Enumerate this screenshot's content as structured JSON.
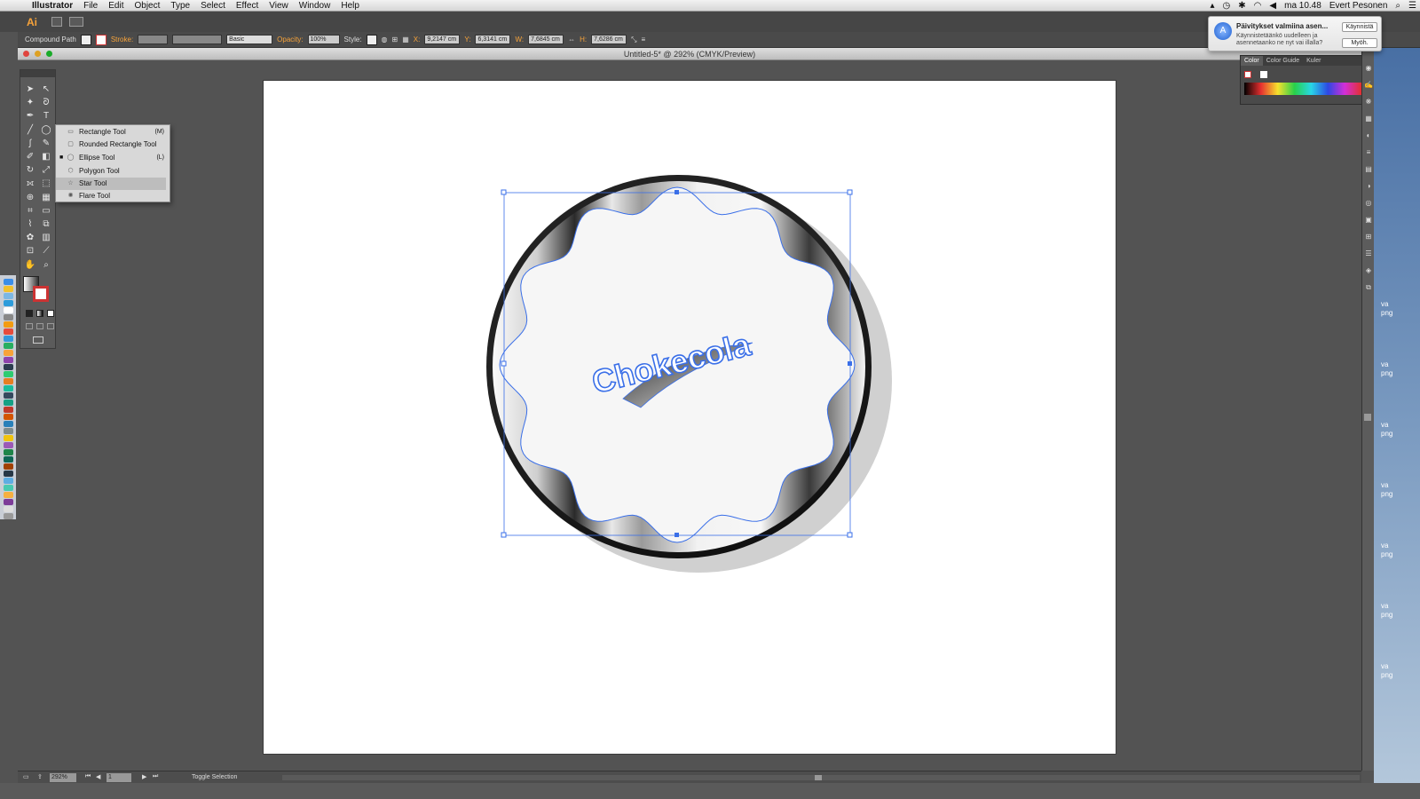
{
  "menubar": {
    "apple_icon": "apple-icon",
    "app": "Illustrator",
    "items": [
      "File",
      "Edit",
      "Object",
      "Type",
      "Select",
      "Effect",
      "View",
      "Window",
      "Help"
    ],
    "clock": "ma 10.48",
    "user": "Evert Pesonen"
  },
  "appbar": {
    "logo": "Ai"
  },
  "control_bar": {
    "selection_type": "Compound Path",
    "stroke_label": "Stroke:",
    "brush_label": "Basic",
    "opacity_label": "Opacity:",
    "opacity_value": "100%",
    "style_label": "Style:",
    "x_label": "X:",
    "x_value": "9,2147 cm",
    "y_label": "Y:",
    "y_value": "6,3141 cm",
    "w_label": "W:",
    "w_value": "7,6845 cm",
    "h_label": "H:",
    "h_value": "7,6286 cm"
  },
  "document": {
    "title": "Untitled-5* @ 292% (CMYK/Preview)"
  },
  "artwork": {
    "text": "Chokecola"
  },
  "flyout": {
    "items": [
      {
        "label": "Rectangle Tool",
        "shortcut": "(M)",
        "icon": "rectangle-icon"
      },
      {
        "label": "Rounded Rectangle Tool",
        "shortcut": "",
        "icon": "rounded-rectangle-icon"
      },
      {
        "label": "Ellipse Tool",
        "shortcut": "(L)",
        "icon": "ellipse-icon",
        "active": true
      },
      {
        "label": "Polygon Tool",
        "shortcut": "",
        "icon": "polygon-icon"
      },
      {
        "label": "Star Tool",
        "shortcut": "",
        "icon": "star-icon",
        "highlighted": true
      },
      {
        "label": "Flare Tool",
        "shortcut": "",
        "icon": "flare-icon"
      }
    ]
  },
  "color_panel": {
    "tabs": [
      "Color",
      "Color Guide",
      "Kuler"
    ]
  },
  "notification": {
    "title": "Päivitykset valmiina asen...",
    "body": "Käynnistetäänkö uudelleen ja asennetaanko ne nyt vai illalla?",
    "button_primary": "Käynnistä",
    "button_secondary": "Myöh."
  },
  "status_bar": {
    "zoom": "292%",
    "page": "1",
    "status": "Toggle Selection"
  },
  "desktop_files": [
    "va",
    "png",
    "va",
    "png",
    "va",
    "png",
    "va",
    "png",
    "va",
    "png",
    "va",
    "png",
    "va",
    "png"
  ],
  "colors": {
    "accent": "#f7a33a",
    "selection": "#3a6fe8",
    "panel": "#535353"
  }
}
